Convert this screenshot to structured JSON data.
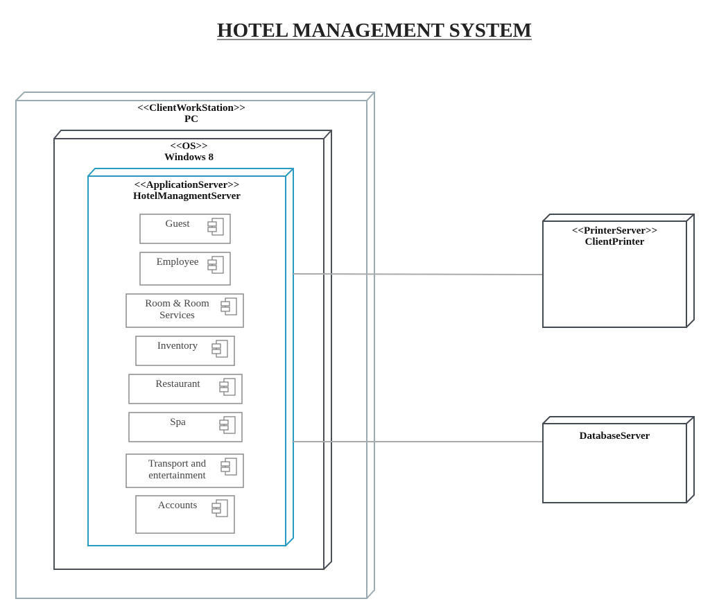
{
  "title": "HOTEL MANAGEMENT SYSTEM",
  "colors": {
    "client_workstation_border": "#9aaab3",
    "os_border": "#4a4f57",
    "app_server_border": "#2a9bc0",
    "component_border": "#8a8a8a",
    "connector": "#aaaaaa",
    "external_node_border": "#444a52"
  },
  "nodes": {
    "client_workstation": {
      "stereotype": "<<ClientWorkStation>>",
      "name": "PC"
    },
    "os": {
      "stereotype": "<<OS>>",
      "name": "Windows 8"
    },
    "app_server": {
      "stereotype": "<<ApplicationServer>>",
      "name": "HotelManagmentServer"
    },
    "printer_server": {
      "stereotype": "<<PrinterServer>>",
      "name": "ClientPrinter"
    },
    "database_server": {
      "stereotype": "",
      "name": "DatabaseServer"
    }
  },
  "components": [
    {
      "label_line1": "Guest",
      "label_line2": "",
      "icon": "component-icon"
    },
    {
      "label_line1": "Employee",
      "label_line2": "",
      "icon": "component-icon"
    },
    {
      "label_line1": "Room & Room",
      "label_line2": "Services",
      "icon": "component-icon"
    },
    {
      "label_line1": "Inventory",
      "label_line2": "",
      "icon": "component-icon"
    },
    {
      "label_line1": "Restaurant",
      "label_line2": "",
      "icon": "component-icon"
    },
    {
      "label_line1": "Spa",
      "label_line2": "",
      "icon": "component-icon"
    },
    {
      "label_line1": "Transport and",
      "label_line2": "entertainment",
      "icon": "component-icon"
    },
    {
      "label_line1": "Accounts",
      "label_line2": "",
      "icon": "component-icon"
    }
  ],
  "connections": [
    {
      "from": "HotelManagmentServer",
      "to": "ClientPrinter"
    },
    {
      "from": "HotelManagmentServer",
      "to": "DatabaseServer"
    }
  ]
}
